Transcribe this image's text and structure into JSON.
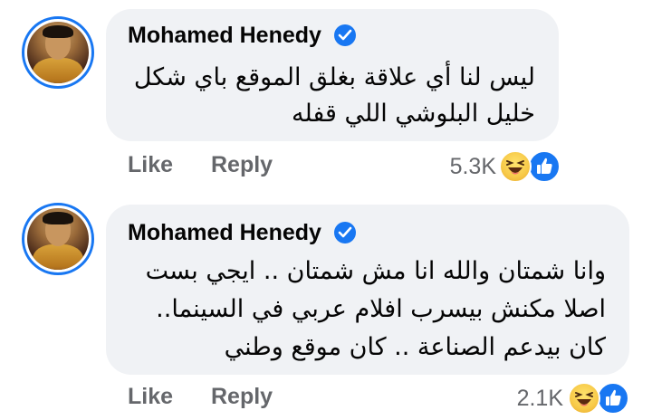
{
  "comments": [
    {
      "author": "Mohamed Henedy",
      "lines": [
        "ليس لنا أي علاقة بغلق الموقع  باي شكل",
        "خليل البلوشي اللي قفله"
      ],
      "like_label": "Like",
      "reply_label": "Reply",
      "reaction_count": "5.3K",
      "reactions": [
        "haha-icon",
        "like-icon"
      ]
    },
    {
      "author": "Mohamed Henedy",
      "lines": [
        "وانا شمتان والله انا مش شمتان .. ايجي بست",
        "اصلا مكنش بيسرب افلام عربي في السينما..",
        "كان بيدعم الصناعة .. كان موقع وطني"
      ],
      "like_label": "Like",
      "reply_label": "Reply",
      "reaction_count": "2.1K",
      "reactions": [
        "haha-icon",
        "like-icon"
      ]
    }
  ],
  "colors": {
    "bubble": "#f0f2f5",
    "verified": "#1877f2",
    "action_text": "#65676b",
    "author_text": "#050505"
  }
}
